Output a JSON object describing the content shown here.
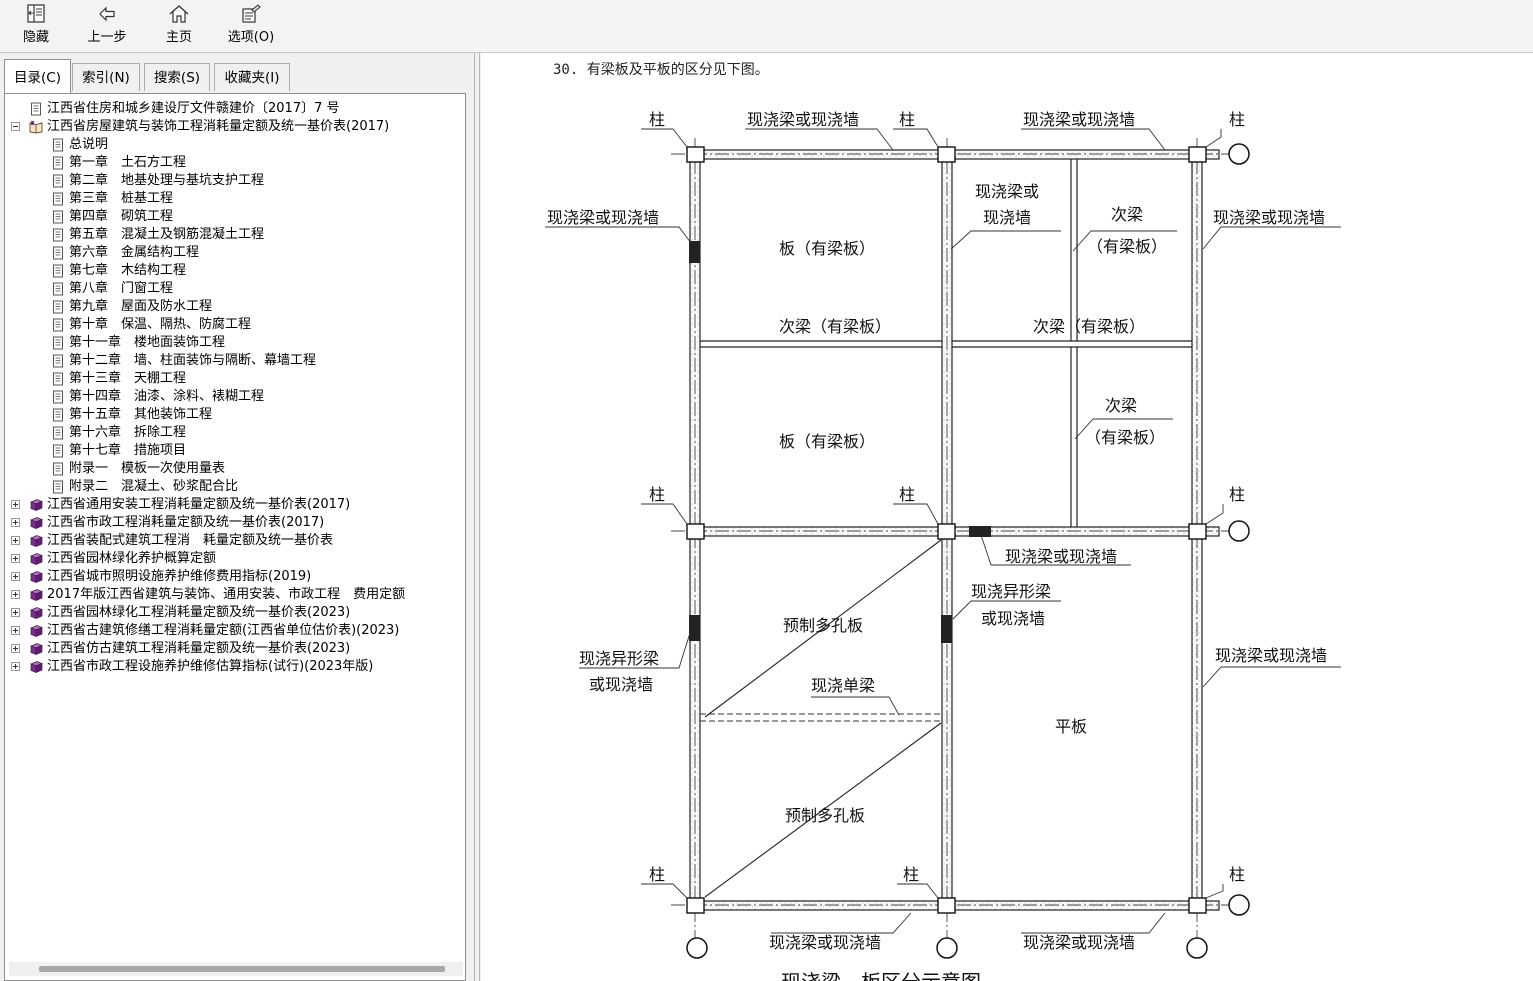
{
  "toolbar": {
    "hide": "隐藏",
    "back": "上一步",
    "home": "主页",
    "options": "选项(O)"
  },
  "tabs": {
    "toc": "目录(C)",
    "index": "索引(N)",
    "search": "搜索(S)",
    "favorites": "收藏夹(I)"
  },
  "tree": [
    {
      "label": "江西省住房和城乡建设厅文件赣建价〔2017〕7 号",
      "level": 0,
      "icon": "page-icon"
    },
    {
      "label": "江西省房屋建筑与装饰工程消耗量定额及统一基价表(2017)",
      "level": 0,
      "icon": "open-book-icon",
      "expander": "minus"
    },
    {
      "label": "总说明",
      "level": 1,
      "icon": "page-icon"
    },
    {
      "label": "第一章　土石方工程",
      "level": 1,
      "icon": "page-icon"
    },
    {
      "label": "第二章　地基处理与基坑支护工程",
      "level": 1,
      "icon": "page-icon"
    },
    {
      "label": "第三章　桩基工程",
      "level": 1,
      "icon": "page-icon"
    },
    {
      "label": "第四章　砌筑工程",
      "level": 1,
      "icon": "page-icon"
    },
    {
      "label": "第五章　混凝土及钢筋混凝土工程",
      "level": 1,
      "icon": "page-icon"
    },
    {
      "label": "第六章　金属结构工程",
      "level": 1,
      "icon": "page-icon"
    },
    {
      "label": "第七章　木结构工程",
      "level": 1,
      "icon": "page-icon"
    },
    {
      "label": "第八章　门窗工程",
      "level": 1,
      "icon": "page-icon"
    },
    {
      "label": "第九章　屋面及防水工程",
      "level": 1,
      "icon": "page-icon"
    },
    {
      "label": "第十章　保温、隔热、防腐工程",
      "level": 1,
      "icon": "page-icon"
    },
    {
      "label": "第十一章　楼地面装饰工程",
      "level": 1,
      "icon": "page-icon"
    },
    {
      "label": "第十二章　墙、柱面装饰与隔断、幕墙工程",
      "level": 1,
      "icon": "page-icon"
    },
    {
      "label": "第十三章　天棚工程",
      "level": 1,
      "icon": "page-icon"
    },
    {
      "label": "第十四章　油漆、涂料、裱糊工程",
      "level": 1,
      "icon": "page-icon"
    },
    {
      "label": "第十五章　其他装饰工程",
      "level": 1,
      "icon": "page-icon"
    },
    {
      "label": "第十六章　拆除工程",
      "level": 1,
      "icon": "page-icon"
    },
    {
      "label": "第十七章　措施项目",
      "level": 1,
      "icon": "page-icon"
    },
    {
      "label": "附录一　模板一次使用量表",
      "level": 1,
      "icon": "page-icon"
    },
    {
      "label": "附录二　混凝土、砂浆配合比",
      "level": 1,
      "icon": "page-icon"
    },
    {
      "label": "江西省通用安装工程消耗量定额及统一基价表(2017)",
      "level": 0,
      "icon": "book-icon",
      "expander": "plus"
    },
    {
      "label": "江西省市政工程消耗量定额及统一基价表(2017)",
      "level": 0,
      "icon": "book-icon",
      "expander": "plus"
    },
    {
      "label": "江西省装配式建筑工程消　耗量定额及统一基价表",
      "level": 0,
      "icon": "book-icon",
      "expander": "plus"
    },
    {
      "label": "江西省园林绿化养护概算定额",
      "level": 0,
      "icon": "book-icon",
      "expander": "plus"
    },
    {
      "label": "江西省城市照明设施养护维修费用指标(2019)",
      "level": 0,
      "icon": "book-icon",
      "expander": "plus"
    },
    {
      "label": "2017年版江西省建筑与装饰、通用安装、市政工程　费用定额",
      "level": 0,
      "icon": "book-icon",
      "expander": "plus"
    },
    {
      "label": "江西省园林绿化工程消耗量定额及统一基价表(2023)",
      "level": 0,
      "icon": "book-icon",
      "expander": "plus"
    },
    {
      "label": "江西省古建筑修缮工程消耗量定额(江西省单位估价表)(2023)",
      "level": 0,
      "icon": "book-icon",
      "expander": "plus"
    },
    {
      "label": "江西省仿古建筑工程消耗量定额及统一基价表(2023)",
      "level": 0,
      "icon": "book-icon",
      "expander": "plus"
    },
    {
      "label": "江西省市政工程设施养护维修估算指标(试行)(2023年版)",
      "level": 0,
      "icon": "book-icon",
      "expander": "plus"
    }
  ],
  "content": {
    "heading": "30. 有梁板及平板的区分见下图。",
    "diagram": {
      "column": "柱",
      "beam_or_wall": "现浇梁或现浇墙",
      "beam_or_l1": "现浇梁或",
      "beam_or_l2": "现浇墙",
      "secondary_beam": "次梁",
      "with_beam_slab_paren": "（有梁板）",
      "secondary_beam_with_slab": "次梁（有梁板）",
      "slab_with_beam": "板（有梁板）",
      "special_beam_l1": "现浇异形梁",
      "special_beam_l2": "或现浇墙",
      "precast_slab": "预制多孔板",
      "single_beam": "现浇单梁",
      "flat_slab": "平板",
      "caption": "现浇梁、板区分示意图"
    }
  },
  "colors": {
    "book": "#7a2f8a",
    "page": "#555555",
    "thumb": "#a8a8a8"
  }
}
